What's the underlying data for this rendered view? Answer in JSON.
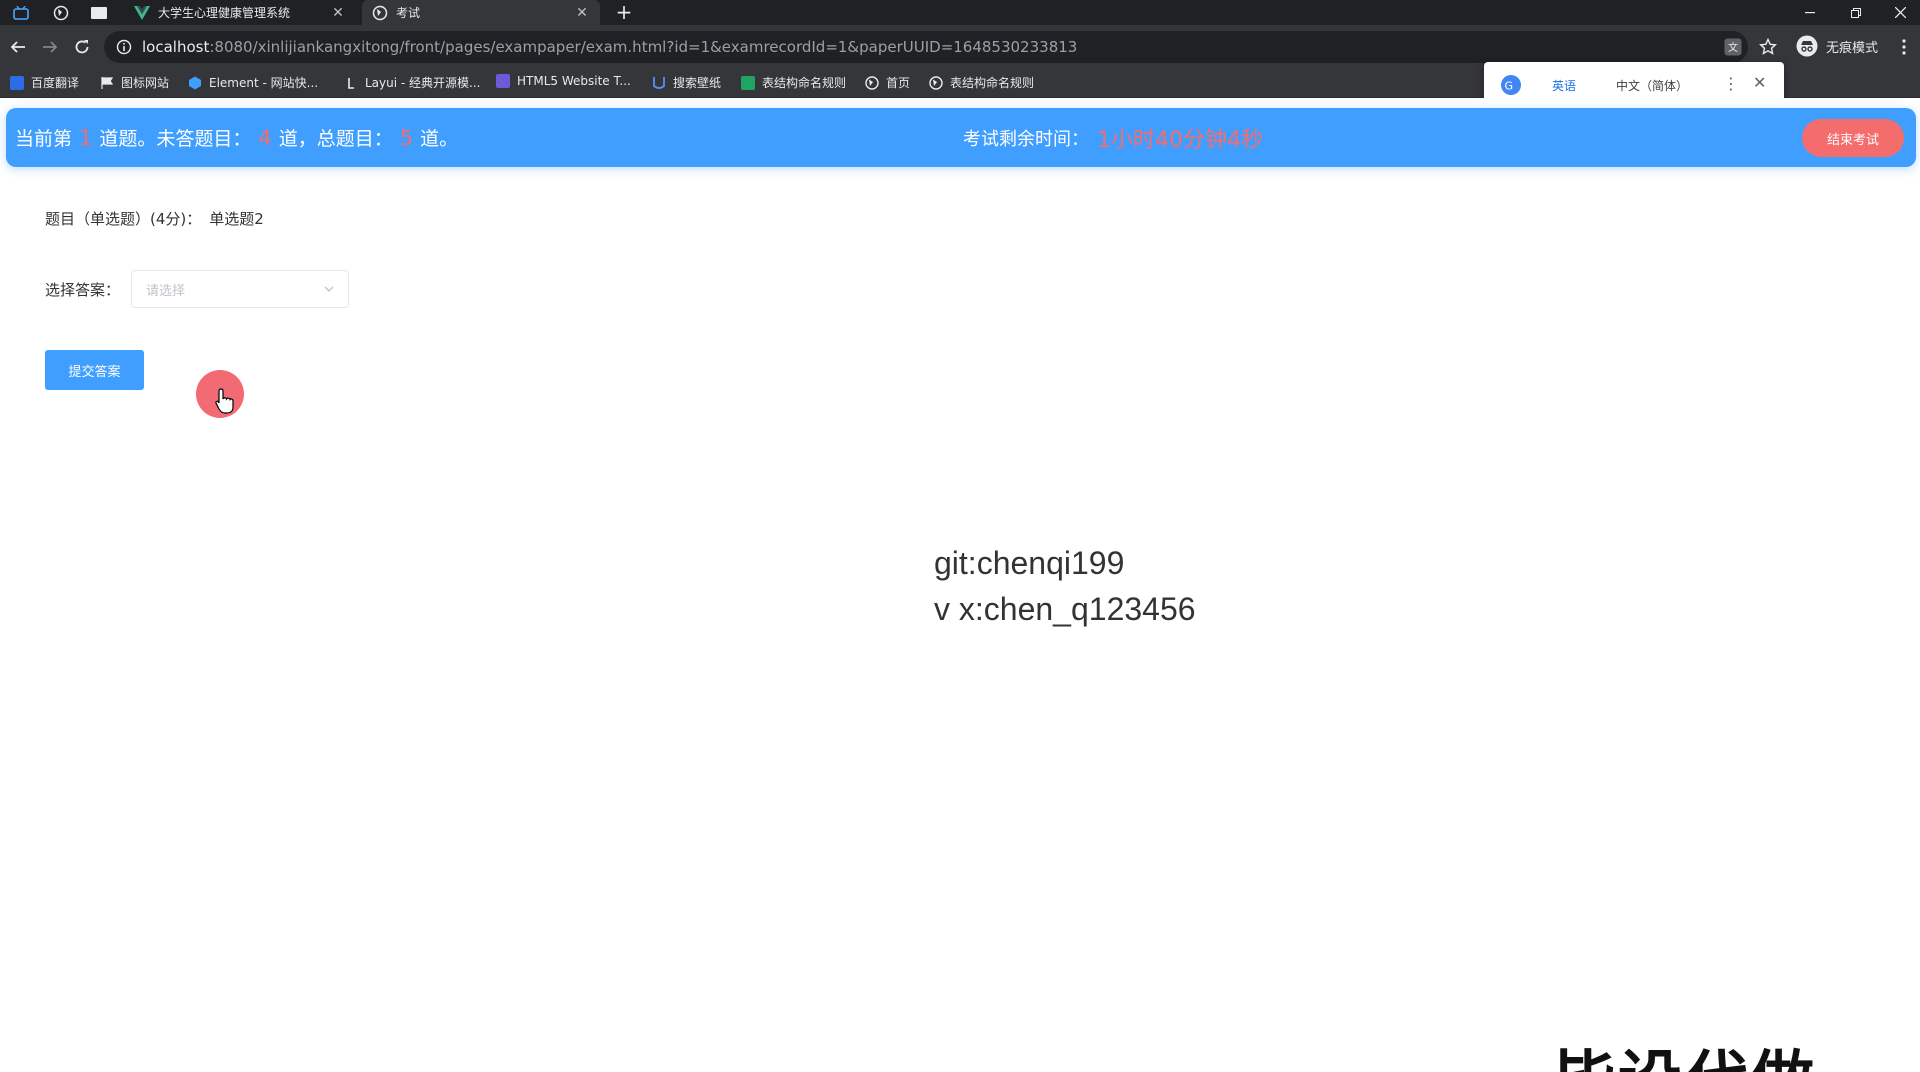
{
  "browser": {
    "tabs": [
      {
        "title": "大学生心理健康管理系统",
        "active": false
      },
      {
        "title": "考试",
        "active": true
      }
    ],
    "new_tab_symbol": "+",
    "url_host": "localhost",
    "url_rest": ":8080/xinlijiankangxitong/front/pages/exampaper/exam.html?id=1&examrecordId=1&paperUUID=1648530233813",
    "incognito_label": "无痕模式",
    "bookmarks": [
      {
        "label": "百度翻译",
        "icon": "baidu-translate-icon",
        "color": "#2b6de4"
      },
      {
        "label": "图标网站",
        "icon": "flag-icon",
        "color": "#e8eaed"
      },
      {
        "label": "Element - 网站快...",
        "icon": "element-icon",
        "color": "#409eff"
      },
      {
        "label": "Layui - 经典开源模...",
        "icon": "layui-icon",
        "color": "#e8eaed"
      },
      {
        "label": "HTML5 Website T...",
        "icon": "html5-icon",
        "color": "#6b5bd6"
      },
      {
        "label": "搜索壁纸",
        "icon": "wallpaper-icon",
        "color": "#5b8def"
      },
      {
        "label": "表结构命名规则",
        "icon": "sheet-icon",
        "color": "#1fa463"
      },
      {
        "label": "首页",
        "icon": "globe-icon",
        "color": "#e8eaed"
      },
      {
        "label": "表结构命名规则",
        "icon": "globe-icon",
        "color": "#e8eaed"
      }
    ],
    "translate_popup": {
      "tabs": [
        "英语",
        "中文（简体）"
      ],
      "active_index": 0
    }
  },
  "header": {
    "current_prefix": "当前第",
    "current_num": "1",
    "current_suffix": "道题。未答题目：",
    "unanswered": "4",
    "unanswered_suffix": "道，总题目：",
    "total": "5",
    "total_suffix": "道。",
    "timer_label": "考试剩余时间：",
    "timer_value": "1小时40分钟4秒",
    "end_button": "结束考试"
  },
  "question": {
    "label": "题目（单选题）(4分)：",
    "text": "单选题2"
  },
  "answer": {
    "label": "选择答案：",
    "placeholder": "请选择"
  },
  "submit_button": "提交答案",
  "watermark": {
    "line1": "git:chenqi199",
    "line2": "v x:chen_q123456"
  },
  "corner_text": "毕设代做",
  "colors": {
    "primary": "#409eff",
    "danger": "#f56c6c",
    "chrome_dark": "#202124",
    "chrome_toolbar": "#35363a"
  }
}
